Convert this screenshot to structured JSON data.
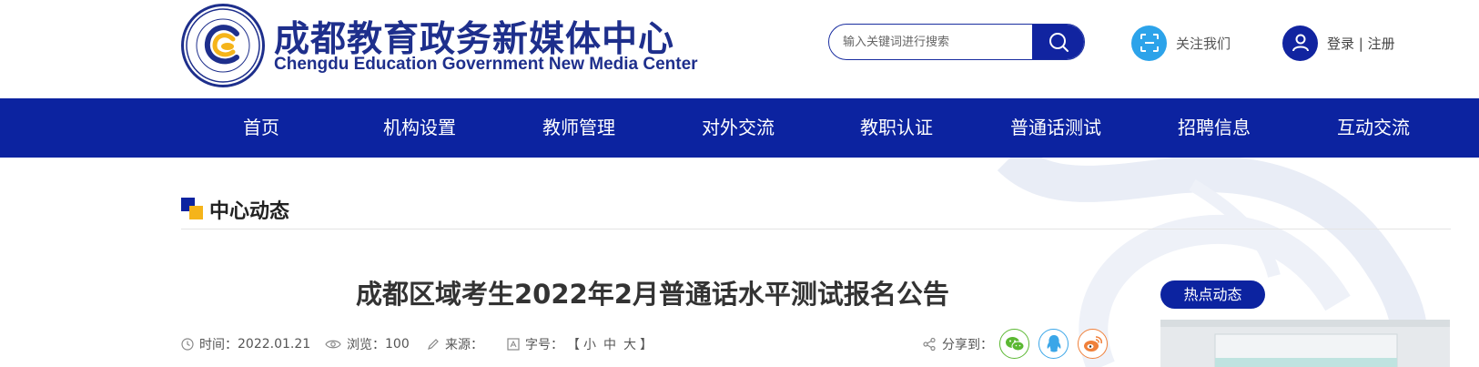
{
  "header": {
    "logo_cn": "成都教育政务新媒体中心",
    "logo_en": "Chengdu Education Government New Media Center",
    "search_placeholder": "输入关键词进行搜索",
    "follow_label": "关注我们",
    "login_label": "登录",
    "login_separator": " | ",
    "register_label": "注册"
  },
  "nav": {
    "items": [
      "首页",
      "机构设置",
      "教师管理",
      "对外交流",
      "教职认证",
      "普通话测试",
      "招聘信息",
      "互动交流"
    ]
  },
  "section": {
    "title": "中心动态"
  },
  "article": {
    "title": "成都区域考生2022年2月普通话水平测试报名公告",
    "time_label": "时间：",
    "time_value": "2022.01.21",
    "views_label": "浏览：",
    "views_value": "100",
    "source_label": "来源：",
    "source_value": "",
    "fontsize_label": "字号：",
    "fontsize_open": "【",
    "fontsize_small": "小",
    "fontsize_medium": "中",
    "fontsize_large": "大",
    "fontsize_close": "】",
    "share_label": "分享到："
  },
  "sidebar": {
    "hot_title": "热点动态"
  },
  "colors": {
    "brand_blue": "#0c23a0",
    "logo_blue": "#1e2f8c",
    "follow_blue": "#2ca3ea",
    "wechat_green": "#5bb832",
    "qq_blue": "#3aa6e8",
    "weibo_orange": "#f0803a",
    "accent_yellow": "#f5b41a"
  },
  "icons": [
    "search-icon",
    "scan-icon",
    "user-icon",
    "clock-icon",
    "eye-icon",
    "pen-icon",
    "font-size-icon",
    "share-icon",
    "wechat-icon",
    "qq-icon",
    "weibo-icon"
  ]
}
